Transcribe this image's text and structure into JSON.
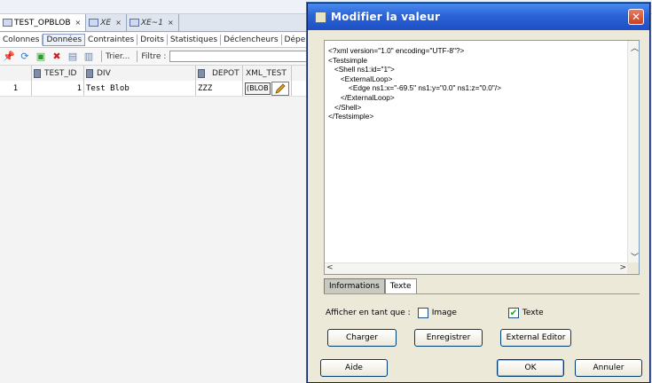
{
  "ide": {
    "doc_tabs": [
      {
        "label": "TEST_OPBLOB",
        "close": "×"
      },
      {
        "label": "XE",
        "close": "×"
      },
      {
        "label": "XE~1",
        "close": "×"
      }
    ],
    "sub_tabs": [
      "Colonnes",
      "Données",
      "Contraintes",
      "Droits",
      "Statistiques",
      "Déclencheurs",
      "Dépendance"
    ],
    "toolbar": {
      "sort_label": "Trier...",
      "filter_label": "Filtre :"
    },
    "grid": {
      "columns": [
        "TEST_ID",
        "DIV",
        "DEPOT",
        "XML_TEST"
      ],
      "rows": [
        {
          "rownum": "1",
          "test_id": "1",
          "div": "Test Blob",
          "depot": "ZZZ",
          "xml_test": "(BLOB"
        }
      ]
    }
  },
  "dialog": {
    "title": "Modifier la valeur",
    "close_glyph": "✕",
    "editor_text": "<?xml version=\"1.0\" encoding=\"UTF-8\"?>\n<Testsimple\n   <Shell ns1:id=\"1\">\n      <ExternalLoop>\n          <Edge ns1:x=\"-69.5\" ns1:y=\"0.0\" ns1:z=\"0.0\"/>\n      </ExternalLoop>\n   </Shell>\n</Testsimple>",
    "tabs": [
      "Informations",
      "Texte"
    ],
    "show_as_label": "Afficher en tant que :",
    "options": [
      {
        "label": "Image",
        "checked": false
      },
      {
        "label": "Texte",
        "checked": true
      }
    ],
    "buttons": {
      "load": "Charger",
      "save": "Enregistrer",
      "external": "External Editor",
      "help": "Aide",
      "ok": "OK",
      "cancel": "Annuler"
    }
  }
}
